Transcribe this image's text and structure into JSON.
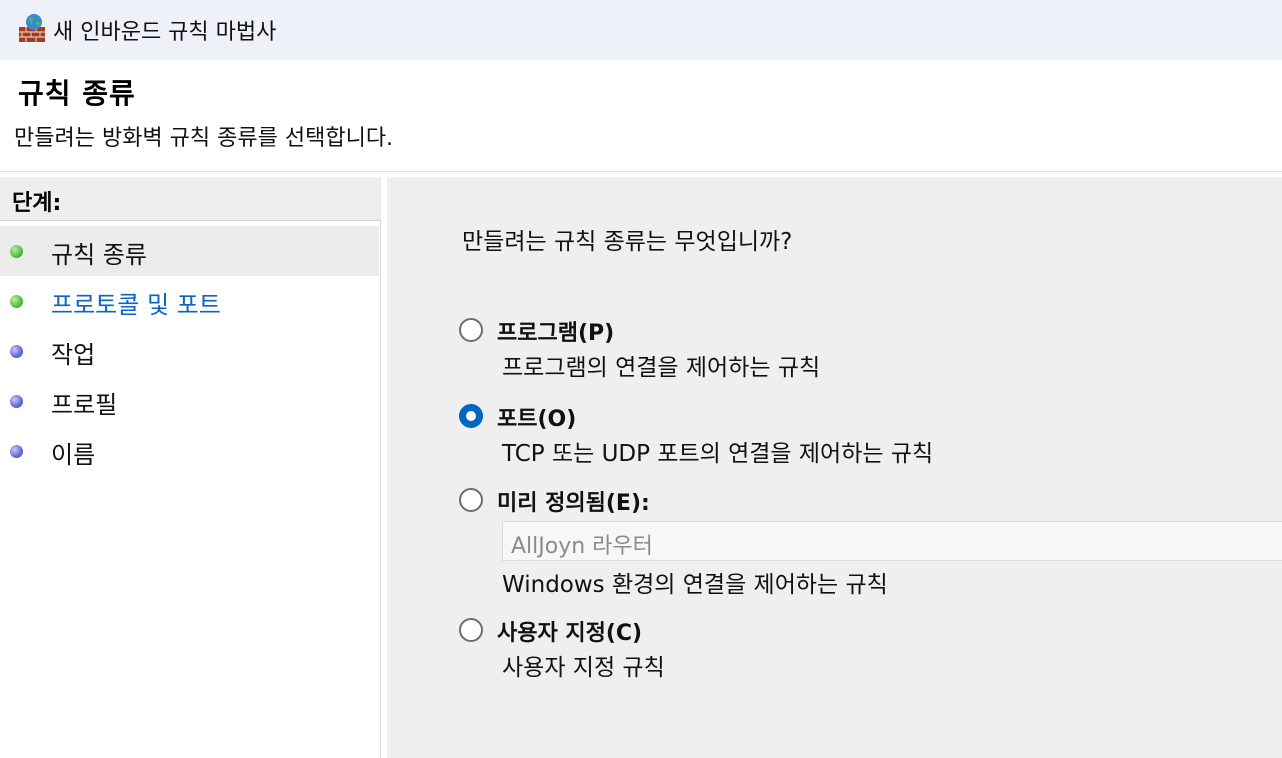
{
  "window": {
    "title": "새 인바운드 규칙 마법사",
    "icon": "firewall-globe-icon"
  },
  "header": {
    "title": "규칙 종류",
    "description": "만들려는 방화벽 규칙 종류를 선택합니다."
  },
  "steps": {
    "heading": "단계:",
    "items": [
      {
        "label": "규칙 종류",
        "status": "done",
        "selected": true
      },
      {
        "label": "프로토콜 및 포트",
        "status": "done",
        "link": true
      },
      {
        "label": "작업",
        "status": "pending"
      },
      {
        "label": "프로필",
        "status": "pending"
      },
      {
        "label": "이름",
        "status": "pending"
      }
    ]
  },
  "content": {
    "question": "만들려는 규칙 종류는 무엇입니까?",
    "options": [
      {
        "label": "프로그램(P)",
        "description": "프로그램의 연결을 제어하는 규칙",
        "checked": false
      },
      {
        "label": "포트(O)",
        "description": "TCP 또는 UDP 포트의 연결을 제어하는 규칙",
        "checked": true
      },
      {
        "label": "미리 정의됨(E):",
        "selected_value": "AllJoyn 라우터",
        "description": "Windows 환경의 연결을 제어하는 규칙",
        "checked": false
      },
      {
        "label": "사용자 지정(C)",
        "description": "사용자 지정 규칙",
        "checked": false
      }
    ]
  },
  "colors": {
    "accent": "#0067c0",
    "link": "#0b63c4",
    "done_dot": "#5cc044",
    "pending_dot": "#6a6fd8"
  }
}
